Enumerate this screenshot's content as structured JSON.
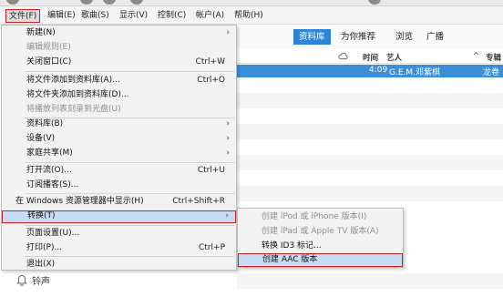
{
  "menubar": {
    "items": [
      "文件(F)",
      "编辑(E)",
      "歌曲(S)",
      "显示(V)",
      "控制(C)",
      "帐户(A)",
      "帮助(H)"
    ]
  },
  "tabs": {
    "items": [
      "资料库",
      "为你推荐",
      "浏览",
      "广播"
    ],
    "selected": "资料库"
  },
  "columns": {
    "time": "时间",
    "artist": "艺人",
    "sort": "^",
    "album": "专辑"
  },
  "track": {
    "time": "4:09",
    "artist": "G.E.M.邓紫棋",
    "album": "龙卷"
  },
  "file_menu": {
    "new": "新建(N)",
    "edit_rules": "编辑规则(E)",
    "close_window": "关闭窗口(C)",
    "close_window_shortcut": "Ctrl+W",
    "add_file": "将文件添加到资料库(A)...",
    "add_file_shortcut": "Ctrl+O",
    "add_folder": "将文件夹添加到资料库(D)...",
    "burn_playlist": "将播放列表刻录到光盘(U)",
    "library": "资料库(B)",
    "devices": "设备(V)",
    "home_sharing": "家庭共享(M)",
    "open_stream": "打开流(O)...",
    "open_stream_shortcut": "Ctrl+U",
    "subscribe_podcast": "订阅播客(S)...",
    "show_in_explorer": "在 Windows 资源管理器中显示(H)",
    "show_in_explorer_shortcut": "Ctrl+Shift+R",
    "convert": "转换(T)",
    "page_setup": "页面设置(U)...",
    "print": "打印(P)...",
    "print_shortcut": "Ctrl+P",
    "exit": "退出(X)"
  },
  "convert_submenu": {
    "ipod_iphone": "创建 iPod 或 iPhone 版本(I)",
    "ipad_appletv": "创建 iPad 或 Apple TV 版本(A)",
    "convert_id3": "转换 ID3 标记...",
    "create_aac": "创建 AAC 版本"
  },
  "sidebar": {
    "ringtones": "铃声"
  },
  "colors": {
    "accent": "#2d85d8",
    "selected_row": "#3b8fd9",
    "menu_highlight": "#c7dcf2",
    "callout_border": "#cc2222"
  }
}
